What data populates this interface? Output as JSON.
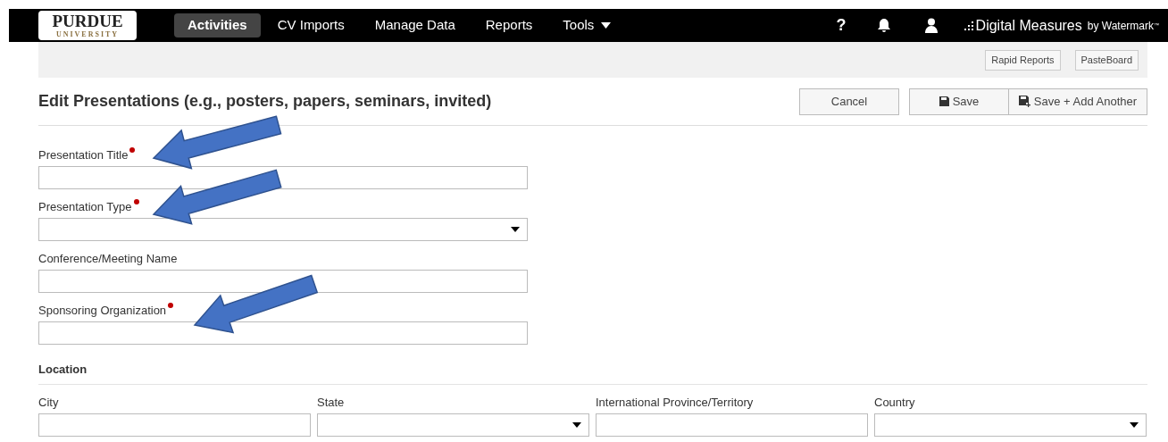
{
  "nav": {
    "logo_title": "PURDUE",
    "logo_subtitle": "UNIVERSITY",
    "items": [
      {
        "label": "Activities",
        "selected": true,
        "dropdown": false
      },
      {
        "label": "CV Imports",
        "selected": false,
        "dropdown": false
      },
      {
        "label": "Manage Data",
        "selected": false,
        "dropdown": false
      },
      {
        "label": "Reports",
        "selected": false,
        "dropdown": false
      },
      {
        "label": "Tools",
        "selected": false,
        "dropdown": true
      }
    ],
    "help": "?",
    "brand": "Digital Measures",
    "brand_suffix": "by Watermark",
    "brand_tm": "™"
  },
  "toolbar": {
    "buttons": [
      "Rapid Reports",
      "PasteBoard"
    ]
  },
  "form": {
    "title": "Edit Presentations (e.g., posters, papers, seminars, invited)",
    "actions": [
      {
        "label": "Cancel",
        "kind": "plain"
      },
      {
        "label": "Save",
        "kind": "save"
      },
      {
        "label": "Save + Add Another",
        "kind": "save-add"
      }
    ],
    "fields": [
      {
        "label": "Presentation Title",
        "required": true,
        "kind": "text"
      },
      {
        "label": "Presentation Type",
        "required": true,
        "kind": "select"
      },
      {
        "label": "Conference/Meeting Name",
        "required": false,
        "kind": "text"
      },
      {
        "label": "Sponsoring Organization",
        "required": true,
        "kind": "text"
      }
    ],
    "section": "Location",
    "location_fields": [
      {
        "label": "City",
        "kind": "text"
      },
      {
        "label": "State",
        "kind": "select"
      },
      {
        "label": "International Province/Territory",
        "kind": "text"
      },
      {
        "label": "Country",
        "kind": "select"
      }
    ]
  }
}
